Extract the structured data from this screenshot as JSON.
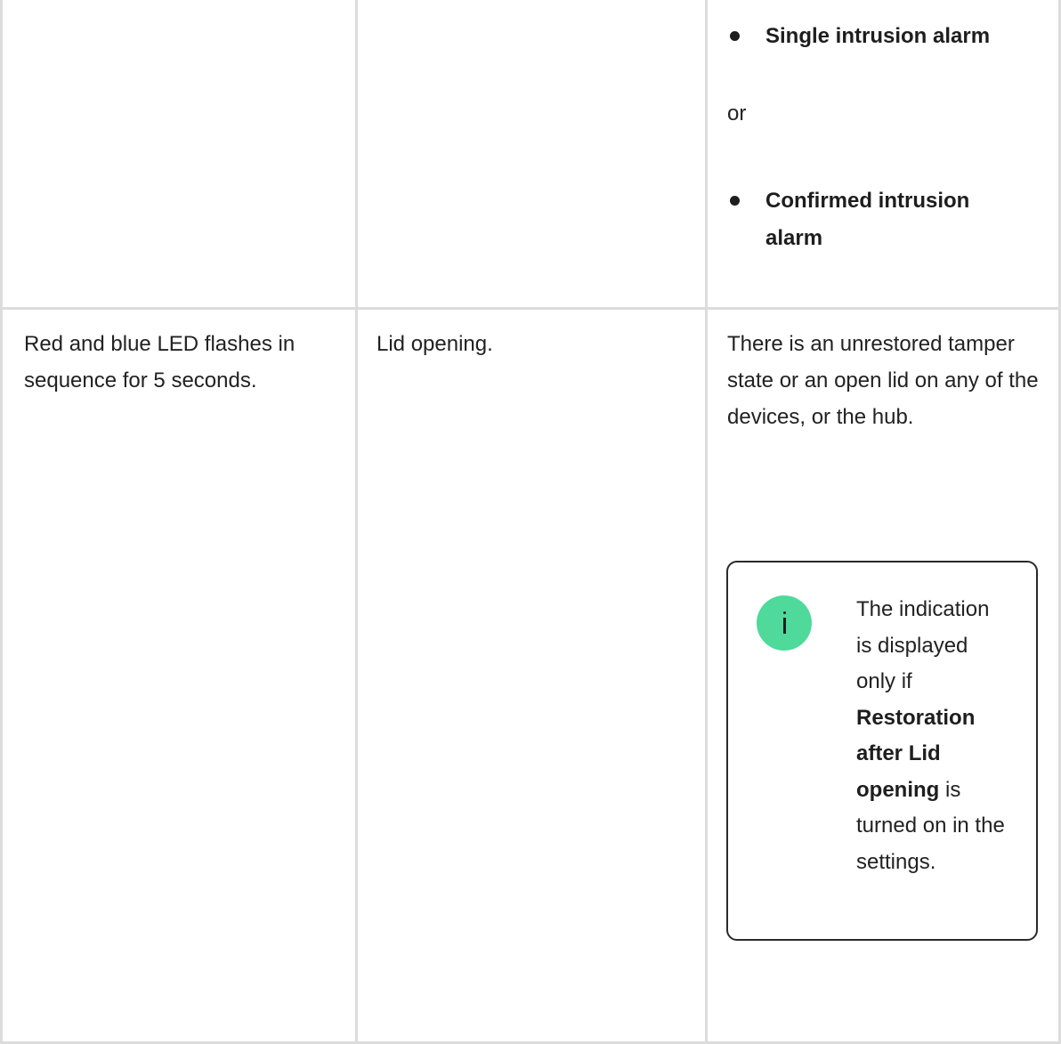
{
  "table": {
    "row1": {
      "bullet_1": "Single intrusion alarm",
      "separator": "or",
      "bullet_2": "Confirmed intrusion alarm"
    },
    "row2": {
      "indication": "Red and blue LED flashes in sequence for 5 seconds.",
      "event": "Lid opening.",
      "note": "There is an unrestored tamper state or an open lid on any of the devices, or the hub.",
      "info_box": {
        "text_before": "The indication is displayed only if",
        "bold_text": "Restoration after Lid opening",
        "text_after": "is turned on in the settings."
      }
    }
  },
  "colors": {
    "border": "#dcdcdc",
    "info_badge": "#4fd99b",
    "text": "#222222"
  },
  "icons": {
    "bullet": "bullet-dot",
    "info": "info-icon"
  }
}
